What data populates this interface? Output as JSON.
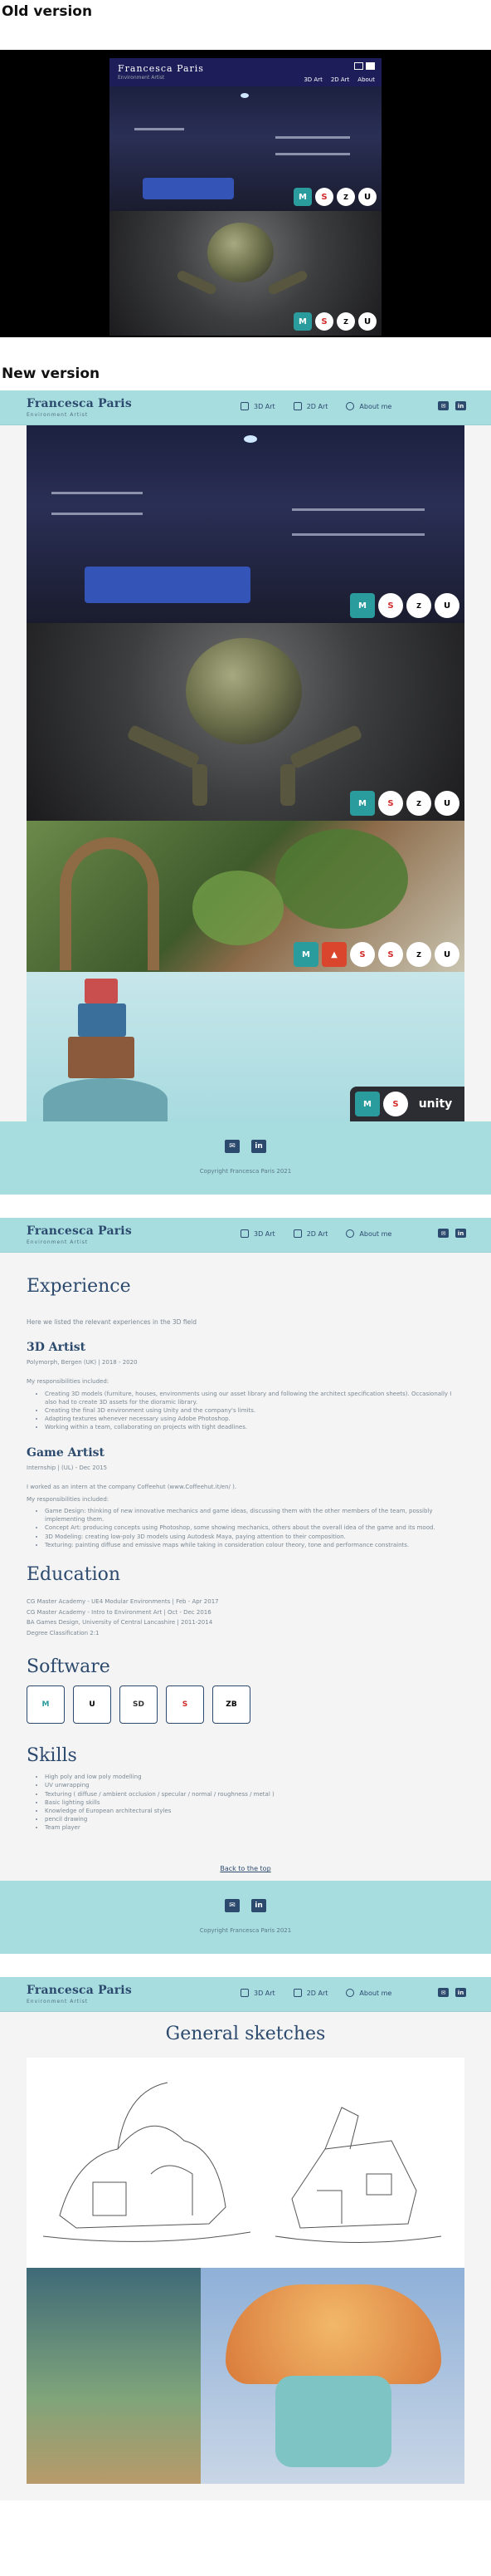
{
  "labels": {
    "old": "Old version",
    "new": "New version"
  },
  "old_site": {
    "brand": "Francesca Paris",
    "brand_sub": "Environment Artist",
    "nav": [
      "3D Art",
      "2D Art",
      "About"
    ]
  },
  "site": {
    "brand": "Francesca Paris",
    "brand_sub": "Environment Artist",
    "nav": [
      "3D Art",
      "2D Art",
      "About me"
    ],
    "copyright": "Copyright Francesca Paris 2021"
  },
  "badges": {
    "maya": "M",
    "substance": "S",
    "zbrush": "Z",
    "unreal": "U",
    "unity": "unity"
  },
  "about": {
    "heading": "Experience",
    "lead": "Here we listed the relevant experiences in the 3D field",
    "job1": {
      "title": "3D Artist",
      "meta": "Polymorph, Bergen (UK) | 2018 - 2020",
      "intro": "My responsibilities included:",
      "bullets": [
        "Creating 3D models (furniture, houses, environments using our asset library and following the architect specification sheets). Occasionally I also had to create 3D assets for the dioramic library.",
        "Creating the final 3D environment using Unity and the company's limits.",
        "Adapting textures whenever necessary using Adobe Photoshop.",
        "Working within a team, collaborating on projects with tight deadlines."
      ]
    },
    "job2": {
      "title": "Game Artist",
      "meta": "Internship | (UL) - Dec 2015",
      "intro1": "I worked as an intern at the company Coffeehut (www.Coffeehut.it/en/ ).",
      "intro2": "My responsibilities included:",
      "bullets": [
        "Game Design: thinking of new innovative mechanics and game ideas, discussing them with the other members of the team, possibly implementing them.",
        "Concept Art: producing concepts using Photoshop, some showing mechanics, others about the overall idea of the game and its mood.",
        "3D Modeling: creating low-poly 3D models using Autodesk Maya, paying attention to their composition.",
        "Texturing: painting diffuse and emissive maps while taking in consideration colour theory, tone and performance constraints."
      ]
    },
    "education_heading": "Education",
    "education": [
      "CG Master Academy - UE4 Modular Environments | Feb - Apr 2017",
      "CG Master Academy - Intro to Environment Art | Oct - Dec 2016",
      "BA Games Design, University of Central Lancashire | 2011-2014",
      "Degree Classification 2:1"
    ],
    "software_heading": "Software",
    "software": [
      "M",
      "U",
      "SD",
      "S",
      "ZB"
    ],
    "skills_heading": "Skills",
    "skills": [
      "High poly and low poly modelling",
      "UV unwrapping",
      "Texturing ( diffuse / ambient occlusion / specular / normal / roughness / metal )",
      "Basic lighting skills",
      "Knowledge of European architectural styles",
      "pencil drawing",
      "Team player"
    ],
    "back_to_top": "Back to the top"
  },
  "sketches": {
    "heading": "General sketches"
  },
  "colors": {
    "topbar": "#a8dde0",
    "accent": "#2c4a6e",
    "page_bg": "#f4f4f4"
  }
}
